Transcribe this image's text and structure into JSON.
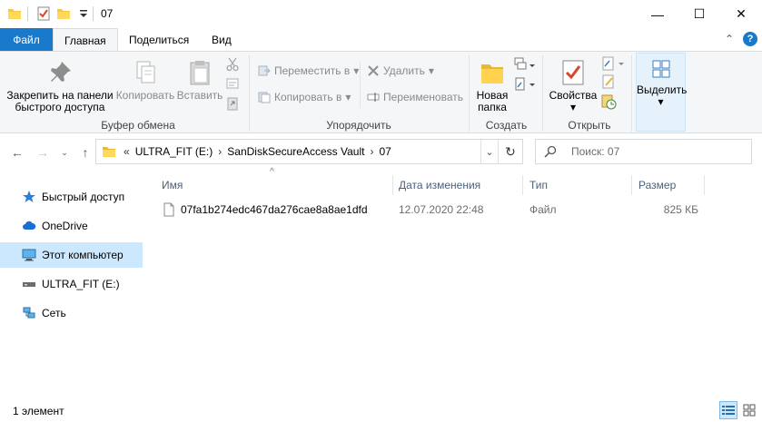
{
  "window": {
    "title": "07",
    "controls": {
      "minimize": "—",
      "maximize": "☐",
      "close": "✕"
    }
  },
  "tabs": [
    {
      "label": "Файл"
    },
    {
      "label": "Главная"
    },
    {
      "label": "Поделиться"
    },
    {
      "label": "Вид"
    }
  ],
  "ribbon": {
    "clipboard": {
      "pin_label_1": "Закрепить на панели",
      "pin_label_2": "быстрого доступа",
      "copy_label": "Копировать",
      "paste_label": "Вставить",
      "group_label": "Буфер обмена"
    },
    "organize": {
      "move_to": "Переместить в",
      "copy_to": "Копировать в",
      "delete": "Удалить",
      "rename": "Переименовать",
      "group_label": "Упорядочить"
    },
    "new": {
      "new_folder_1": "Новая",
      "new_folder_2": "папка",
      "group_label": "Создать"
    },
    "open": {
      "properties": "Свойства",
      "group_label": "Открыть"
    },
    "select": {
      "select_label": "Выделить"
    }
  },
  "address": {
    "overflow": "«",
    "crumbs": [
      "ULTRA_FIT (E:)",
      "SanDiskSecureAccess Vault",
      "07"
    ],
    "separator": "›",
    "refresh": "↻",
    "dropdown": "⌄"
  },
  "search": {
    "placeholder": "Поиск: 07"
  },
  "sidebar": {
    "items": [
      {
        "label": "Быстрый доступ",
        "icon": "star-icon"
      },
      {
        "label": "OneDrive",
        "icon": "cloud-icon"
      },
      {
        "label": "Этот компьютер",
        "icon": "computer-icon"
      },
      {
        "label": "ULTRA_FIT (E:)",
        "icon": "usb-drive-icon"
      },
      {
        "label": "Сеть",
        "icon": "network-icon"
      }
    ]
  },
  "columns": {
    "name": "Имя",
    "date": "Дата изменения",
    "type": "Тип",
    "size": "Размер"
  },
  "files": [
    {
      "name": "07fa1b274edc467da276cae8a8ae1dfd",
      "date": "12.07.2020 22:48",
      "type": "Файл",
      "size": "825 КБ"
    }
  ],
  "status": {
    "count": "1 элемент"
  },
  "colors": {
    "file_tab": "#1979ca",
    "ribbon_bg": "#f5f6f7",
    "selected": "#cce8ff",
    "header_text": "#4c607a"
  }
}
